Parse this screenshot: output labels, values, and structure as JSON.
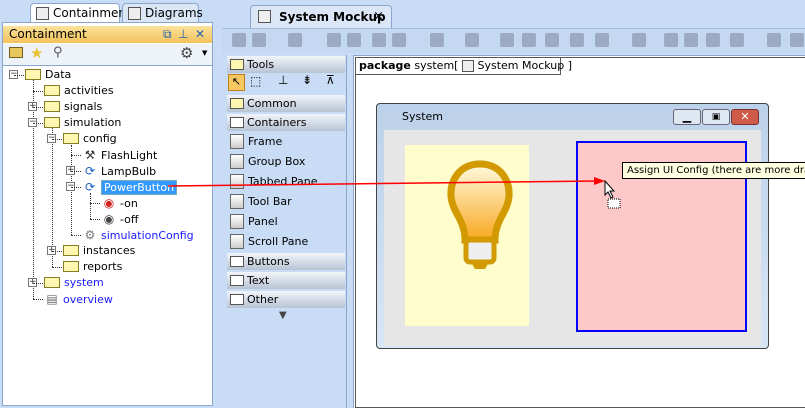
{
  "left_tabs": [
    {
      "label": "Containment",
      "active": true
    },
    {
      "label": "Diagrams",
      "active": false
    }
  ],
  "containment": {
    "title": "Containment",
    "header_icons": [
      "float-icon",
      "pin-icon",
      "close-icon"
    ],
    "toolbar_icons": [
      "open-folder-icon",
      "star-icon",
      "search-icon",
      "gear-icon"
    ],
    "tree": [
      {
        "label": "Data",
        "level": 0,
        "icon": "package-icon",
        "expander": "minus"
      },
      {
        "label": "activities",
        "level": 1,
        "icon": "folder-icon",
        "expander": ""
      },
      {
        "label": "signals",
        "level": 1,
        "icon": "folder-icon",
        "expander": "plus"
      },
      {
        "label": "simulation",
        "level": 1,
        "icon": "folder-icon",
        "expander": "minus"
      },
      {
        "label": "config",
        "level": 2,
        "icon": "folder-icon",
        "expander": "minus"
      },
      {
        "label": "FlashLight",
        "level": 3,
        "icon": "tools-icon",
        "expander": ""
      },
      {
        "label": "LampBulb",
        "level": 3,
        "icon": "state-machine-icon",
        "expander": "plus"
      },
      {
        "label": "PowerButton",
        "level": 3,
        "icon": "state-machine-icon",
        "expander": "minus",
        "selected": true
      },
      {
        "label": "-on",
        "level": 4,
        "icon": "button-on-icon",
        "expander": ""
      },
      {
        "label": "-off",
        "level": 4,
        "icon": "button-off-icon",
        "expander": ""
      },
      {
        "label": "simulationConfig",
        "level": 3,
        "icon": "config-icon",
        "expander": "",
        "blue": true
      },
      {
        "label": "instances",
        "level": 2,
        "icon": "folder-icon",
        "expander": "plus"
      },
      {
        "label": "reports",
        "level": 2,
        "icon": "folder-icon",
        "expander": ""
      },
      {
        "label": "system",
        "level": 1,
        "icon": "folder-icon",
        "expander": "plus",
        "blue": true
      },
      {
        "label": "overview",
        "level": 1,
        "icon": "document-icon",
        "expander": "",
        "blue": true
      }
    ]
  },
  "editor": {
    "tab_label": "System Mockup",
    "close": "×"
  },
  "palette": {
    "tools_label": "Tools",
    "groups": [
      "Common",
      "Containers"
    ],
    "items": [
      "Frame",
      "Group Box",
      "Tabbed Pane",
      "Tool Bar",
      "Panel",
      "Scroll Pane"
    ],
    "more_groups": [
      "Buttons",
      "Text",
      "Other"
    ]
  },
  "canvas": {
    "package_keyword": "package",
    "package_name": "system",
    "bracket_open": "[",
    "diagram_name": "System Mockup",
    "bracket_close": "]",
    "window_title": "System",
    "tooltip": "Assign UI Config (there are more drag"
  },
  "colors": {
    "selection": "#3399ff",
    "header": "#f8c860",
    "arrow": "#ff0000",
    "drop_target": "#0000ff"
  }
}
